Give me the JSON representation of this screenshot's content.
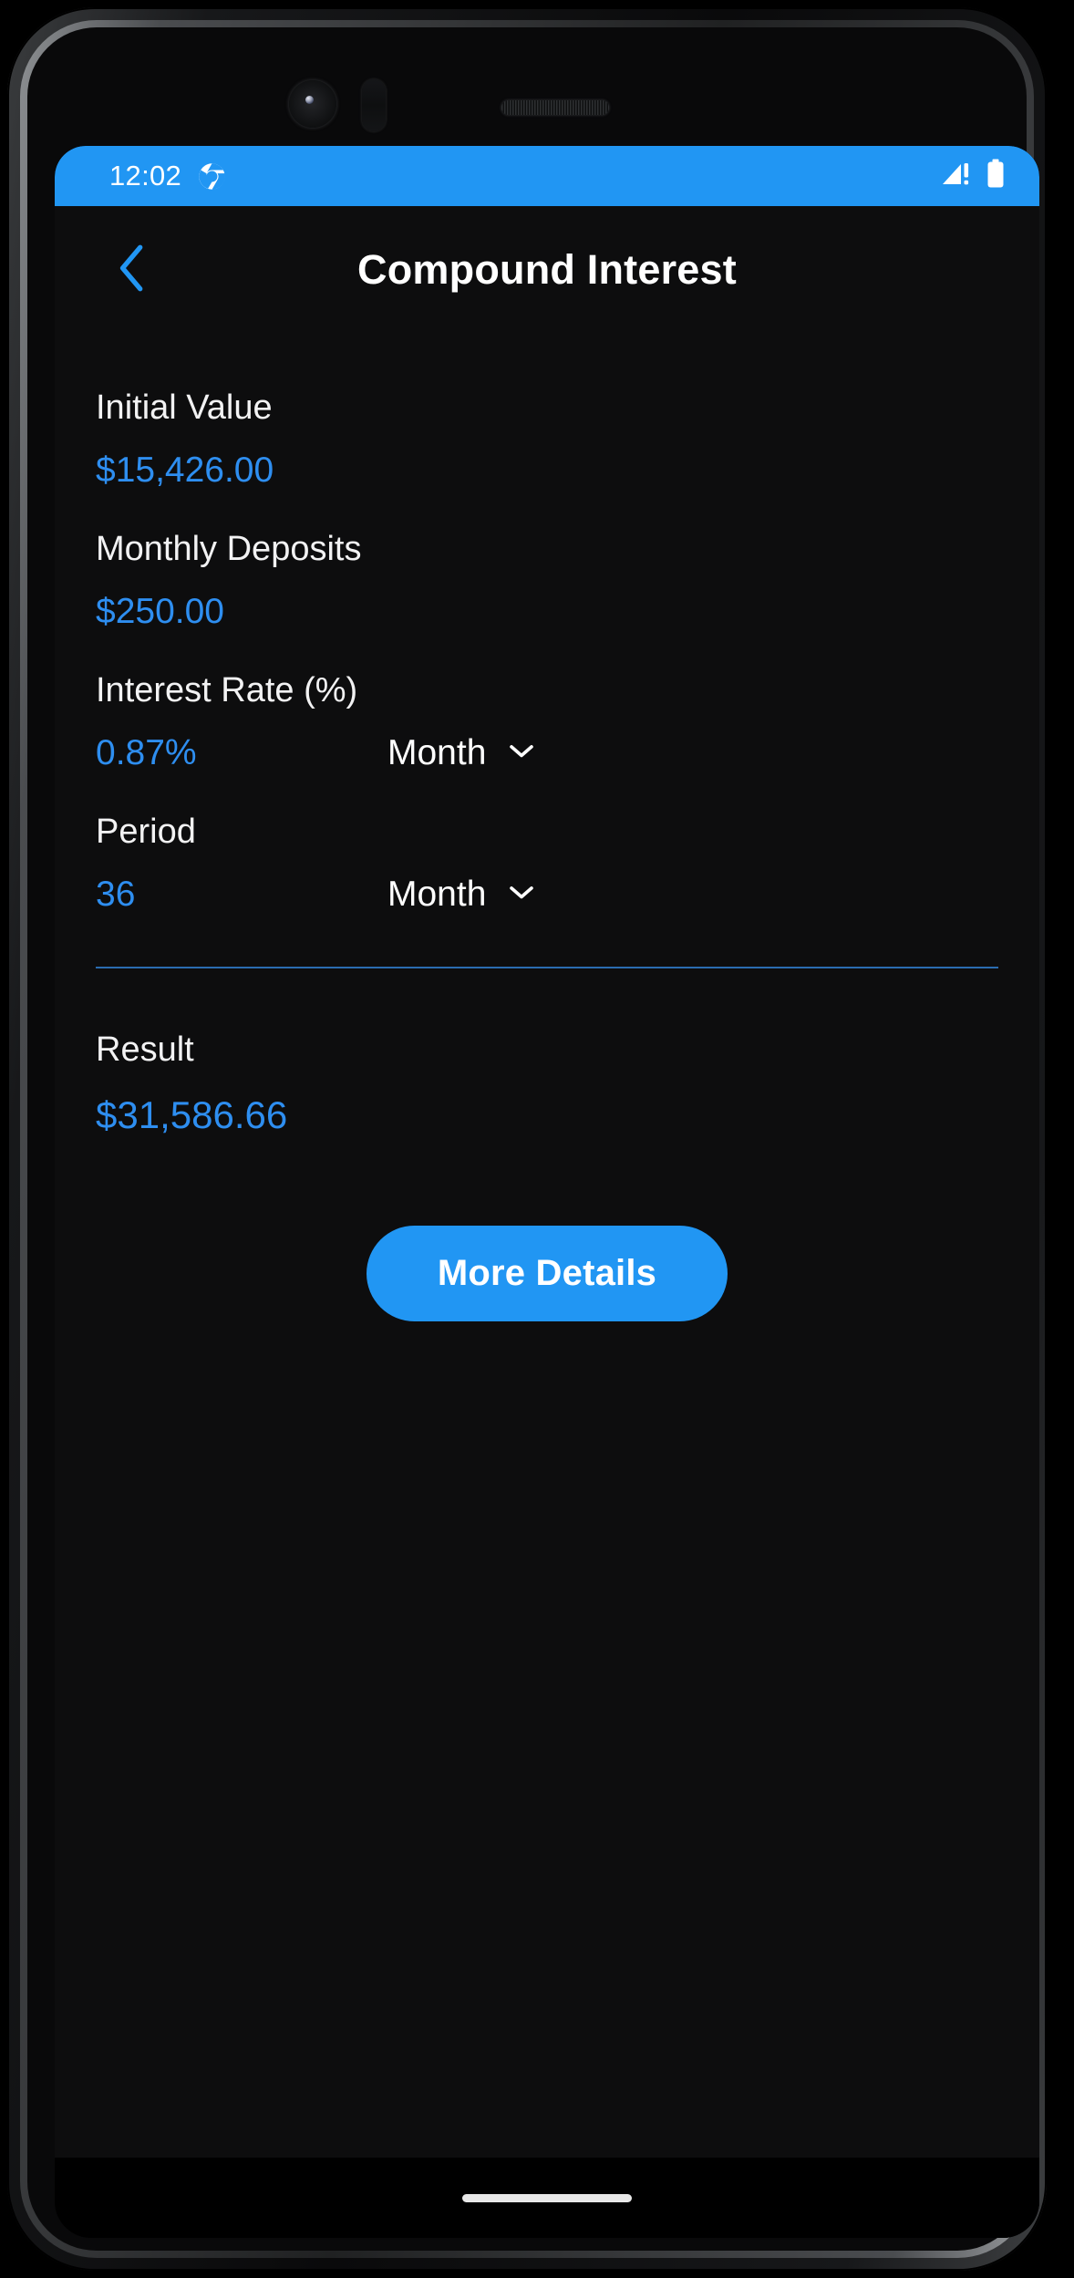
{
  "status_bar": {
    "time": "12:02",
    "notification_icon": "chrome-icon",
    "signal_icon": "cellular-signal-no-service-icon",
    "battery_icon": "battery-full-icon",
    "background_color": "#2196f3"
  },
  "app_bar": {
    "back_icon": "chevron-left-icon",
    "title": "Compound Interest"
  },
  "theme": {
    "accent_color": "#2196f3",
    "value_color": "#2e8ef0",
    "background_color": "#0d0d0e",
    "text_color": "#ffffff",
    "divider_color": "#2a6cb0"
  },
  "fields": [
    {
      "label": "Initial Value",
      "value": "$15,426.00",
      "has_unit": false,
      "unit": ""
    },
    {
      "label": "Monthly Deposits",
      "value": "$250.00",
      "has_unit": false,
      "unit": ""
    },
    {
      "label": "Interest Rate (%)",
      "value": "0.87%",
      "has_unit": true,
      "unit": "Month"
    },
    {
      "label": "Period",
      "value": "36",
      "has_unit": true,
      "unit": "Month"
    }
  ],
  "result": {
    "label": "Result",
    "value": "$31,586.66"
  },
  "actions": {
    "more_details_label": "More Details"
  },
  "nav_bar": {
    "home_indicator": "home-indicator-pill"
  }
}
